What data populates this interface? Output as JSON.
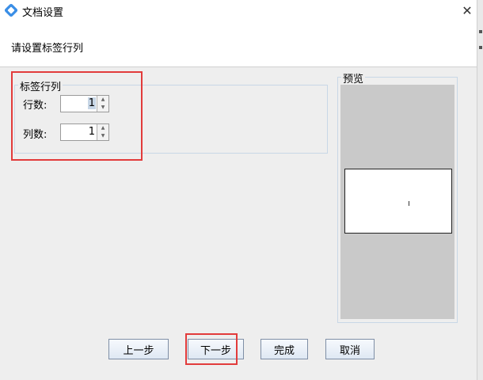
{
  "window": {
    "title": "文档设置",
    "close_glyph": "✕"
  },
  "header": {
    "prompt": "请设置标签行列"
  },
  "label_group": {
    "legend": "标签行列",
    "rows_label": "行数:",
    "rows_value": "1",
    "cols_label": "列数:",
    "cols_value": "1"
  },
  "preview": {
    "legend": "预览"
  },
  "buttons": {
    "prev": "上一步",
    "next": "下一步",
    "finish": "完成",
    "cancel": "取消"
  },
  "colors": {
    "highlight_box": "#e23b3b",
    "preview_background": "#c9c9c9",
    "dialog_background": "#eeeeee"
  },
  "icons": [
    "app-icon",
    "close-icon",
    "spinner-up-icon",
    "spinner-down-icon"
  ]
}
